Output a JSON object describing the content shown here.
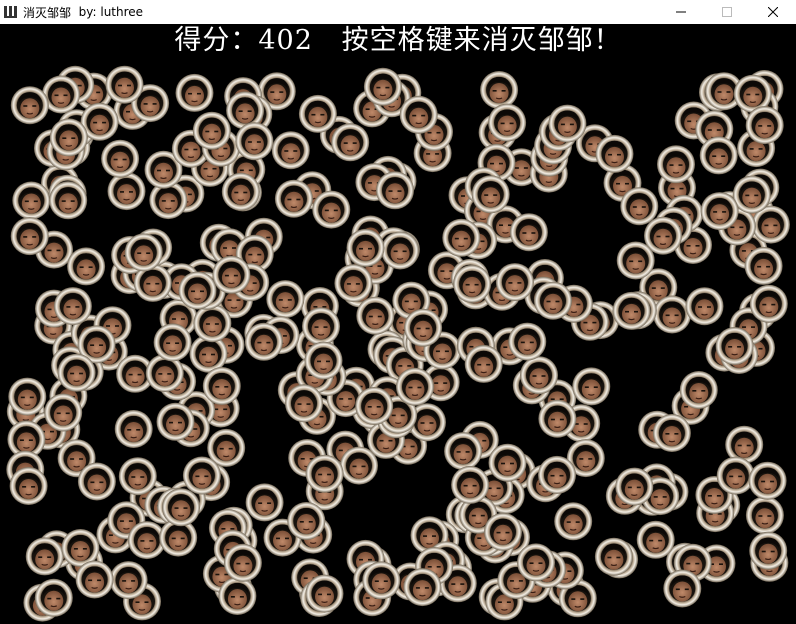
{
  "window": {
    "title": "消灭邹邹",
    "author": "by: luthree",
    "icon": "app-icon",
    "controls": [
      "minimize-icon",
      "maximize-icon",
      "close-icon"
    ]
  },
  "game": {
    "score_label": "得分：",
    "score": "402",
    "hint": "按空格键来消灭邹邹！",
    "background_color": "#000000",
    "sprite": "face-ball-icon"
  }
}
